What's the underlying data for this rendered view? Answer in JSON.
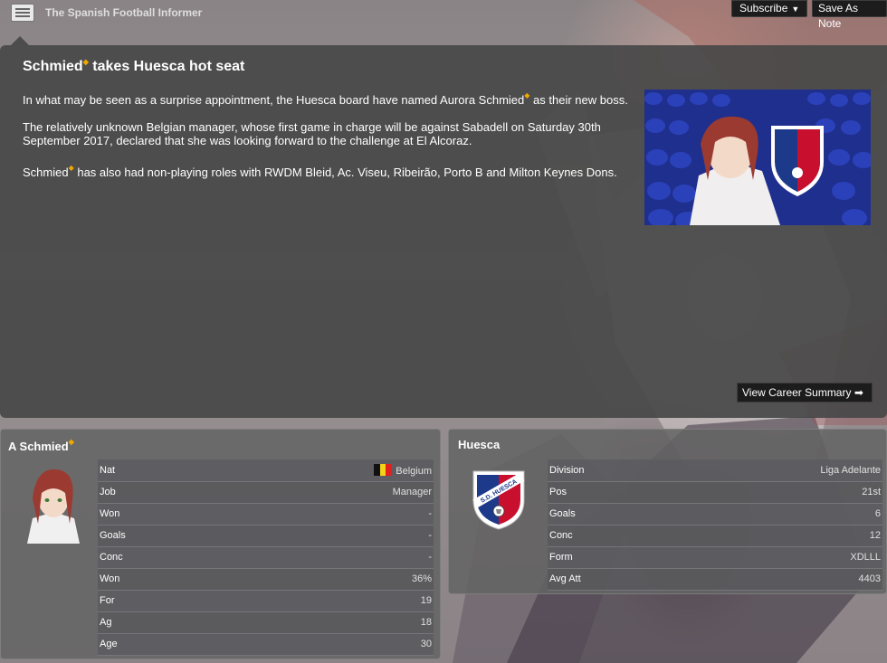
{
  "topbar": {
    "source": "The Spanish Football Informer",
    "subscribe_label": "Subscribe",
    "save_note_label": "Save As Note"
  },
  "article": {
    "headline_name": "Schmied",
    "headline_rest": " takes Huesca hot seat",
    "para1_a": "In what may be seen as a surprise appointment, the Huesca board have named Aurora Schmied",
    "para1_b": " as their new boss.",
    "para2": "The relatively unknown Belgian manager, whose first game in charge will be against Sabadell on Saturday 30th September 2017, declared that she was looking forward to the challenge at El Alcoraz.",
    "para3_a": "Schmied",
    "para3_b": " has also had non-playing roles with RWDM Bleid, Ac. Viseu, Ribeirão, Porto B and Milton Keynes Dons.",
    "view_career_label": "View Career Summary ➡"
  },
  "manager_panel": {
    "title": "A Schmied",
    "rows": [
      {
        "label": "Nat",
        "value": "Belgium"
      },
      {
        "label": "Job",
        "value": "Manager"
      },
      {
        "label": "Won",
        "value": "-"
      },
      {
        "label": "Goals",
        "value": "-"
      },
      {
        "label": "Conc",
        "value": "-"
      },
      {
        "label": "Won",
        "value": "36%"
      },
      {
        "label": "For",
        "value": "19"
      },
      {
        "label": "Ag",
        "value": "18"
      },
      {
        "label": "Age",
        "value": "30"
      }
    ]
  },
  "club_panel": {
    "title": "Huesca",
    "crest_text": "S.D. HUESCA",
    "rows": [
      {
        "label": "Division",
        "value": "Liga Adelante"
      },
      {
        "label": "Pos",
        "value": "21st"
      },
      {
        "label": "Goals",
        "value": "6"
      },
      {
        "label": "Conc",
        "value": "12"
      },
      {
        "label": "Form",
        "value": "XDLLL"
      },
      {
        "label": "Avg Att",
        "value": "4403"
      }
    ]
  },
  "colors": {
    "star": "#f0a800",
    "crest_blue": "#1d3a8a",
    "crest_red": "#c8102e"
  }
}
